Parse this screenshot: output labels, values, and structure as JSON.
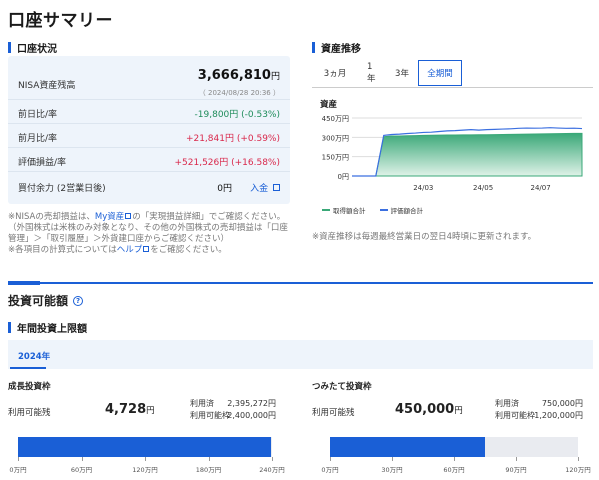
{
  "page_title": "口座サマリー",
  "account": {
    "section_title": "口座状況",
    "nisa_label": "NISA資産残高",
    "nisa_value": "3,666,810",
    "nisa_unit": "円",
    "nisa_time": "（ 2024/08/28 20:36 ）",
    "rows": [
      {
        "label": "前日比/率",
        "value": "-19,800円 (-0.53%)",
        "tone": "neg"
      },
      {
        "label": "前月比/率",
        "value": "+21,841円 (+0.59%)",
        "tone": "pos"
      },
      {
        "label": "評価損益/率",
        "value": "+521,526円 (+16.58%)",
        "tone": "pos"
      }
    ],
    "buying_power_label": "買付余力 (2営業日後)",
    "buying_power_value": "0円",
    "deposit_link": "入金"
  },
  "account_notes": {
    "line1_a": "※NISAの売却損益は、",
    "line1_link": "My資産",
    "line1_b": "の「実現損益詳細」でご確認ください。",
    "line2": "（外国株式は米株のみ対象となり、その他の外国株式の売却損益は「口座",
    "line3": "管理」＞「取引履歴」＞外貨建口座からご確認ください）",
    "line4_a": "※各項目の計算式については",
    "line4_link": "ヘルプ",
    "line4_b": "をご確認ください。"
  },
  "asset_trend": {
    "section_title": "資産推移",
    "tabs": [
      "3ヵ月",
      "1年",
      "3年",
      "全期間"
    ],
    "active_tab": "全期間",
    "chart_title": "資産",
    "legend_cost": "取得額合計",
    "legend_value": "評価額合計",
    "note": "※資産推移は毎週最終営業日の翌日4時頃に更新されます。",
    "color_cost": "#3aa878",
    "color_value": "#3b6fe0"
  },
  "chart_data": {
    "type": "area",
    "title": "資産",
    "y_ticks": [
      "0円",
      "150万円",
      "300万円",
      "450万円"
    ],
    "ylim": [
      0,
      4500000
    ],
    "x_ticks": [
      "24/03",
      "24/05",
      "24/07"
    ],
    "series": [
      {
        "name": "取得額合計",
        "type": "area",
        "color": "#3aa878",
        "values": [
          0,
          0,
          0,
          0,
          3050000,
          3100000,
          3100000,
          3120000,
          3130000,
          3150000,
          3160000,
          3170000,
          3180000,
          3180000,
          3190000,
          3190000,
          3200000,
          3200000,
          3210000,
          3220000,
          3230000,
          3240000,
          3250000,
          3260000,
          3270000,
          3280000,
          3290000,
          3300000,
          3310000,
          3310000
        ]
      },
      {
        "name": "評価額合計",
        "type": "line",
        "color": "#3b6fe0",
        "values": [
          0,
          0,
          0,
          0,
          3150000,
          3220000,
          3250000,
          3300000,
          3330000,
          3380000,
          3400000,
          3450000,
          3500000,
          3520000,
          3560000,
          3600000,
          3560000,
          3600000,
          3620000,
          3640000,
          3660000,
          3700000,
          3720000,
          3710000,
          3720000,
          3750000,
          3720000,
          3700000,
          3710000,
          3680000
        ]
      }
    ]
  },
  "investable": {
    "title": "投資可能額",
    "help_icon": "question-icon",
    "annual_title": "年間投資上限額",
    "year_tab": "2024年",
    "growth": {
      "title": "成長投資枠",
      "available_label": "利用可能残",
      "available_value": "4,728",
      "unit": "円",
      "used_label": "利用済",
      "used_value": "2,395,272円",
      "limit_label": "利用可能枠",
      "limit_value": "2,400,000円",
      "used_fraction": 0.998,
      "ticks": [
        "0万円",
        "60万円",
        "120万円",
        "180万円",
        "240万円"
      ]
    },
    "tsumitate": {
      "title": "つみたて投資枠",
      "available_label": "利用可能残",
      "available_value": "450,000",
      "unit": "円",
      "used_label": "利用済",
      "used_value": "750,000円",
      "limit_label": "利用可能枠",
      "limit_value": "1,200,000円",
      "used_fraction": 0.625,
      "ticks": [
        "0万円",
        "30万円",
        "60万円",
        "90万円",
        "120万円"
      ]
    }
  }
}
